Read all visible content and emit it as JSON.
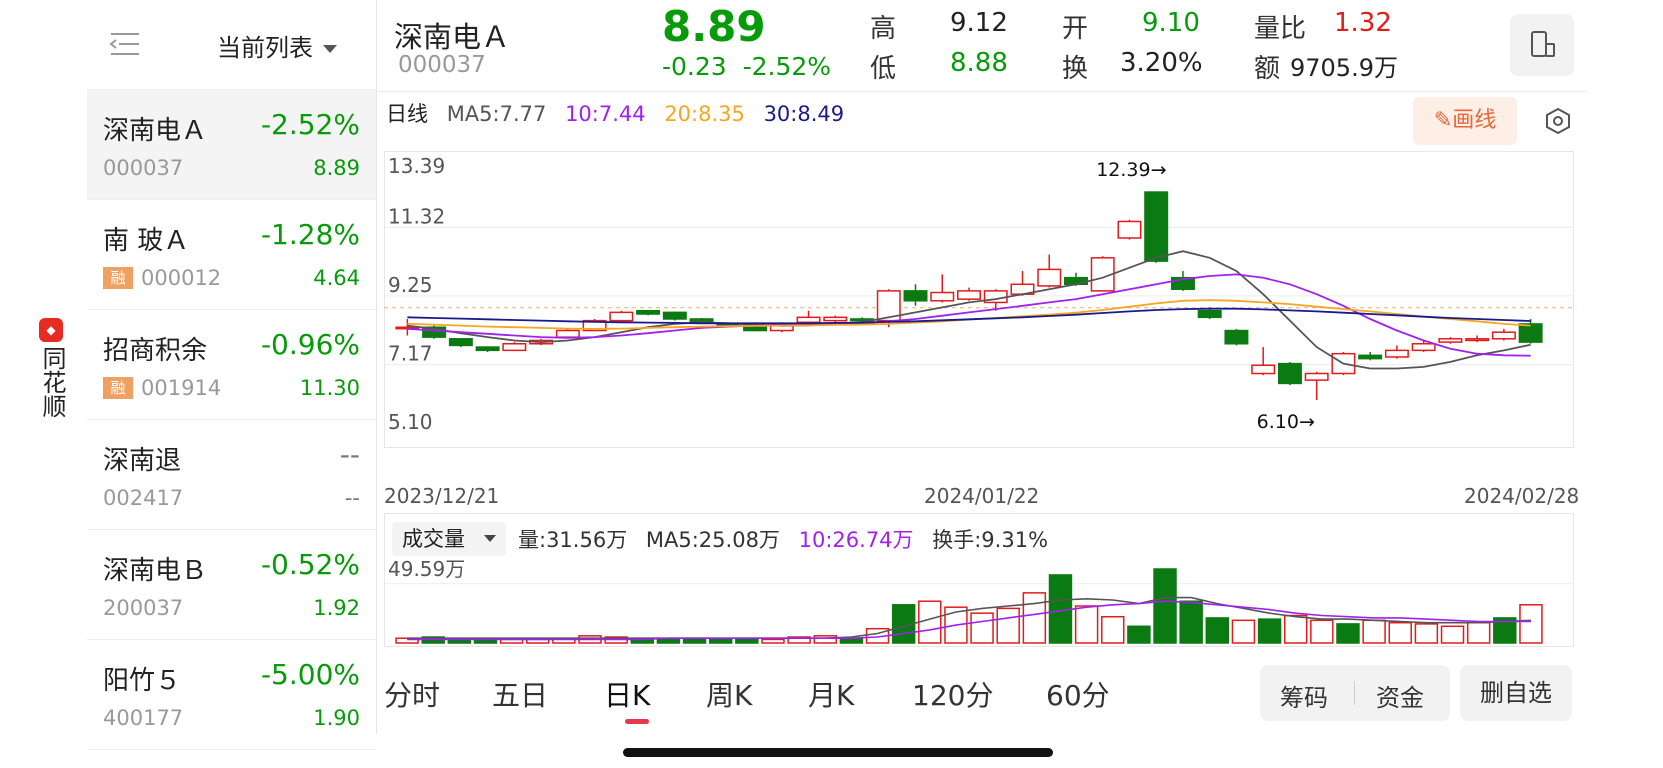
{
  "brand": {
    "name": "同花顺",
    "icon": "app-logo-icon"
  },
  "sidebar": {
    "list_label": "当前列表",
    "back_icon": "collapse-menu-icon",
    "items": [
      {
        "name": "深南电Ａ",
        "pct": "-2.52%",
        "code": "000037",
        "price": "8.89",
        "badge": "",
        "color": "green"
      },
      {
        "name": "南 玻Ａ",
        "pct": "-1.28%",
        "code": "000012",
        "price": "4.64",
        "badge": "融",
        "color": "green"
      },
      {
        "name": "招商积余",
        "pct": "-0.96%",
        "code": "001914",
        "price": "11.30",
        "badge": "融",
        "color": "green"
      },
      {
        "name": "深南退",
        "pct": "--",
        "code": "002417",
        "price": "--",
        "badge": "",
        "color": "gray"
      },
      {
        "name": "深南电Ｂ",
        "pct": "-0.52%",
        "code": "200037",
        "price": "1.92",
        "badge": "",
        "color": "green"
      },
      {
        "name": "阳竹５",
        "pct": "-5.00%",
        "code": "400177",
        "price": "1.90",
        "badge": "",
        "color": "green"
      }
    ]
  },
  "header": {
    "name": "深南电Ａ",
    "code": "000037",
    "price": "8.89",
    "change": "-0.23",
    "change_pct": "-2.52%",
    "high_label": "高",
    "high": "9.12",
    "low_label": "低",
    "low": "8.88",
    "open_label": "开",
    "open": "9.10",
    "turnover_label": "换",
    "turnover": "3.20%",
    "vol_ratio_label": "量比",
    "vol_ratio": "1.32",
    "amount_label": "额",
    "amount": "9705.9万",
    "device_icon": "device-switch-icon"
  },
  "ma": {
    "period": "日线",
    "ma5": "MA5:7.77",
    "ma10": "10:7.44",
    "ma20": "20:8.35",
    "ma30": "30:8.49",
    "colors": {
      "ma5": "#555555",
      "ma10": "#a020f0",
      "ma20": "#f5a623",
      "ma30": "#1a1a8c"
    }
  },
  "tools": {
    "draw_label": "✎画线",
    "settings_icon": "hexagon-settings-icon"
  },
  "chart_data": {
    "type": "candlestick",
    "y_ticks": [
      "13.39",
      "11.32",
      "9.25",
      "7.17",
      "5.10"
    ],
    "ylim": [
      5.1,
      13.39
    ],
    "x_labels": [
      "2023/12/21",
      "2024/01/22",
      "2024/02/28"
    ],
    "max_annotation": "12.39→",
    "min_annotation": "6.10→",
    "candles": [
      {
        "o": 8.3,
        "c": 8.3,
        "h": 8.55,
        "l": 8.05
      },
      {
        "o": 8.3,
        "c": 8.0,
        "h": 8.35,
        "l": 7.95
      },
      {
        "o": 7.95,
        "c": 7.75,
        "h": 7.95,
        "l": 7.7
      },
      {
        "o": 7.7,
        "c": 7.6,
        "h": 7.72,
        "l": 7.55
      },
      {
        "o": 7.6,
        "c": 7.8,
        "h": 7.85,
        "l": 7.58
      },
      {
        "o": 7.8,
        "c": 7.9,
        "h": 7.95,
        "l": 7.76
      },
      {
        "o": 8.0,
        "c": 8.2,
        "h": 8.25,
        "l": 7.98
      },
      {
        "o": 8.2,
        "c": 8.5,
        "h": 8.55,
        "l": 8.18
      },
      {
        "o": 8.5,
        "c": 8.75,
        "h": 8.8,
        "l": 8.48
      },
      {
        "o": 8.8,
        "c": 8.7,
        "h": 8.82,
        "l": 8.66
      },
      {
        "o": 8.75,
        "c": 8.55,
        "h": 8.77,
        "l": 8.5
      },
      {
        "o": 8.55,
        "c": 8.45,
        "h": 8.58,
        "l": 8.42
      },
      {
        "o": 8.4,
        "c": 8.35,
        "h": 8.42,
        "l": 8.3
      },
      {
        "o": 8.4,
        "c": 8.2,
        "h": 8.45,
        "l": 8.18
      },
      {
        "o": 8.2,
        "c": 8.4,
        "h": 8.45,
        "l": 8.15
      },
      {
        "o": 8.45,
        "c": 8.6,
        "h": 8.8,
        "l": 8.43
      },
      {
        "o": 8.5,
        "c": 8.6,
        "h": 8.65,
        "l": 8.45
      },
      {
        "o": 8.55,
        "c": 8.5,
        "h": 8.6,
        "l": 8.47
      },
      {
        "o": 8.5,
        "c": 9.4,
        "h": 9.45,
        "l": 8.3
      },
      {
        "o": 9.4,
        "c": 9.1,
        "h": 9.6,
        "l": 8.95
      },
      {
        "o": 9.1,
        "c": 9.35,
        "h": 9.9,
        "l": 9.05
      },
      {
        "o": 9.15,
        "c": 9.4,
        "h": 9.5,
        "l": 9.1
      },
      {
        "o": 9.05,
        "c": 9.4,
        "h": 9.45,
        "l": 8.8
      },
      {
        "o": 9.3,
        "c": 9.6,
        "h": 10.0,
        "l": 9.25
      },
      {
        "o": 9.55,
        "c": 10.05,
        "h": 10.5,
        "l": 9.5
      },
      {
        "o": 9.8,
        "c": 9.6,
        "h": 9.95,
        "l": 9.55
      },
      {
        "o": 9.4,
        "c": 10.4,
        "h": 10.45,
        "l": 9.38
      },
      {
        "o": 11.0,
        "c": 11.5,
        "h": 11.55,
        "l": 10.95
      },
      {
        "o": 12.39,
        "c": 10.3,
        "h": 12.39,
        "l": 10.25
      },
      {
        "o": 9.8,
        "c": 9.45,
        "h": 10.0,
        "l": 9.4
      },
      {
        "o": 8.8,
        "c": 8.6,
        "h": 8.9,
        "l": 8.55
      },
      {
        "o": 8.2,
        "c": 7.8,
        "h": 8.25,
        "l": 7.75
      },
      {
        "o": 6.9,
        "c": 7.15,
        "h": 7.7,
        "l": 6.85
      },
      {
        "o": 7.2,
        "c": 6.6,
        "h": 7.25,
        "l": 6.55
      },
      {
        "o": 6.7,
        "c": 6.9,
        "h": 6.95,
        "l": 6.1
      },
      {
        "o": 6.9,
        "c": 7.5,
        "h": 7.55,
        "l": 6.85
      },
      {
        "o": 7.45,
        "c": 7.35,
        "h": 7.55,
        "l": 7.3
      },
      {
        "o": 7.4,
        "c": 7.6,
        "h": 7.75,
        "l": 7.35
      },
      {
        "o": 7.6,
        "c": 7.8,
        "h": 7.9,
        "l": 7.55
      },
      {
        "o": 7.85,
        "c": 7.95,
        "h": 8.0,
        "l": 7.8
      },
      {
        "o": 7.9,
        "c": 7.95,
        "h": 8.05,
        "l": 7.85
      },
      {
        "o": 7.95,
        "c": 8.15,
        "h": 8.25,
        "l": 7.9
      },
      {
        "o": 8.4,
        "c": 7.85,
        "h": 8.55,
        "l": 7.8
      }
    ],
    "ma_series": {
      "ma5": [
        8.35,
        8.25,
        8.12,
        8.0,
        7.9,
        7.85,
        7.9,
        8.0,
        8.15,
        8.3,
        8.4,
        8.45,
        8.42,
        8.38,
        8.34,
        8.36,
        8.4,
        8.45,
        8.6,
        8.75,
        8.9,
        9.05,
        9.15,
        9.3,
        9.45,
        9.6,
        9.8,
        10.1,
        10.4,
        10.6,
        10.4,
        10.0,
        9.3,
        8.5,
        7.7,
        7.2,
        7.05,
        7.05,
        7.1,
        7.25,
        7.45,
        7.6,
        7.77
      ],
      "ma10": [
        8.25,
        8.2,
        8.15,
        8.1,
        8.05,
        8.0,
        7.98,
        8.0,
        8.05,
        8.12,
        8.2,
        8.28,
        8.32,
        8.35,
        8.37,
        8.38,
        8.4,
        8.42,
        8.48,
        8.55,
        8.65,
        8.75,
        8.85,
        8.95,
        9.05,
        9.15,
        9.3,
        9.45,
        9.6,
        9.75,
        9.85,
        9.9,
        9.8,
        9.6,
        9.3,
        8.95,
        8.55,
        8.2,
        7.9,
        7.65,
        7.5,
        7.45,
        7.44
      ],
      "ma20": [
        8.4,
        8.38,
        8.35,
        8.32,
        8.3,
        8.28,
        8.26,
        8.25,
        8.26,
        8.28,
        8.3,
        8.32,
        8.33,
        8.34,
        8.35,
        8.36,
        8.37,
        8.38,
        8.4,
        8.44,
        8.48,
        8.53,
        8.58,
        8.63,
        8.68,
        8.74,
        8.82,
        8.92,
        9.02,
        9.1,
        9.12,
        9.1,
        9.05,
        9.0,
        8.92,
        8.85,
        8.78,
        8.7,
        8.62,
        8.55,
        8.48,
        8.4,
        8.35
      ],
      "ma30": [
        8.6,
        8.58,
        8.56,
        8.54,
        8.52,
        8.5,
        8.48,
        8.46,
        8.45,
        8.44,
        8.43,
        8.42,
        8.42,
        8.42,
        8.42,
        8.42,
        8.43,
        8.44,
        8.46,
        8.48,
        8.51,
        8.54,
        8.57,
        8.6,
        8.64,
        8.68,
        8.73,
        8.78,
        8.82,
        8.85,
        8.86,
        8.86,
        8.84,
        8.81,
        8.78,
        8.74,
        8.7,
        8.66,
        8.62,
        8.58,
        8.55,
        8.52,
        8.49
      ]
    },
    "ref_price": 8.89
  },
  "volume": {
    "selector_label": "成交量",
    "vol": "量:31.56万",
    "ma5": "MA5:25.08万",
    "ma10": "10:26.74万",
    "turnover": "换手:9.31%",
    "y_tick": "49.59万",
    "bars": [
      4,
      5,
      3,
      4,
      3,
      3,
      4,
      6,
      5,
      4,
      4,
      4,
      3,
      4,
      3,
      5,
      6,
      4,
      12,
      32,
      35,
      30,
      25,
      29,
      42,
      57,
      31,
      22,
      14,
      62,
      35,
      21,
      19,
      20,
      23,
      19,
      16,
      19,
      17,
      16,
      14,
      17,
      21,
      32
    ],
    "ma5_line": [
      4,
      4,
      4,
      4,
      4,
      4,
      4,
      4,
      4,
      4,
      4,
      4,
      4,
      4,
      4,
      4,
      4,
      5,
      8,
      14,
      20,
      26,
      29,
      31,
      33,
      36,
      37,
      36,
      33,
      38,
      38,
      33,
      29,
      25,
      22,
      20,
      20,
      19,
      18,
      17,
      17,
      17,
      18,
      19
    ],
    "ma10_line": [
      3,
      3,
      3,
      3,
      3,
      3,
      3,
      3,
      3,
      3,
      4,
      4,
      4,
      4,
      4,
      4,
      4,
      4,
      5,
      8,
      11,
      15,
      18,
      21,
      24,
      27,
      30,
      32,
      33,
      35,
      34,
      32,
      30,
      28,
      25,
      23,
      22,
      21,
      21,
      20,
      19,
      18,
      18,
      18
    ]
  },
  "tabs": [
    "分时",
    "五日",
    "日K",
    "周K",
    "月K",
    "120分",
    "60分"
  ],
  "active_tab": "日K",
  "chips": {
    "chip1": "筹码",
    "chip2": "资金",
    "delete": "删自选"
  }
}
